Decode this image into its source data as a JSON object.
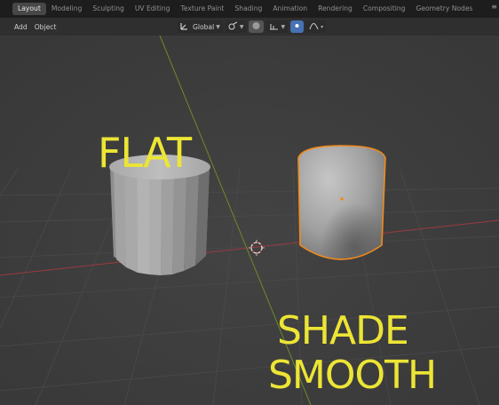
{
  "workspaces": [
    {
      "label": "Layout",
      "active": true
    },
    {
      "label": "Modeling",
      "active": false
    },
    {
      "label": "Sculpting",
      "active": false
    },
    {
      "label": "UV Editing",
      "active": false
    },
    {
      "label": "Texture Paint",
      "active": false
    },
    {
      "label": "Shading",
      "active": false
    },
    {
      "label": "Animation",
      "active": false
    },
    {
      "label": "Rendering",
      "active": false
    },
    {
      "label": "Compositing",
      "active": false
    },
    {
      "label": "Geometry Nodes",
      "active": false
    }
  ],
  "header": {
    "menu": [
      "Add",
      "Object"
    ],
    "orientation_label": "Global"
  },
  "viewport": {
    "caption_left": "FLAT",
    "caption_right_line1": "SHADE",
    "caption_right_line2": "SMOOTH",
    "caption_color": "#ece535",
    "selection_outline_color": "#f08a1c"
  },
  "icons": [
    "transform-orientation-icon",
    "snap-icon",
    "proportional-edit-icon",
    "falloff-icon",
    "3d-cursor-icon",
    "chevron-down-icon"
  ]
}
